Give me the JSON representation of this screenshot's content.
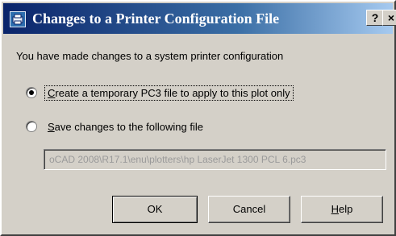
{
  "window": {
    "title": "Changes to a Printer Configuration File",
    "help_glyph": "?",
    "close_glyph": "×"
  },
  "message": "You have made changes to a system printer configuration",
  "options": [
    {
      "accel": "C",
      "rest": "reate a temporary PC3 file to apply to this plot only",
      "selected": true
    },
    {
      "accel": "S",
      "rest": "ave changes to the following file",
      "selected": false
    }
  ],
  "file_path": "oCAD 2008\\R17.1\\enu\\plotters\\hp LaserJet 1300 PCL 6.pc3",
  "buttons": {
    "ok": "OK",
    "cancel": "Cancel",
    "help_accel": "H",
    "help_rest": "elp"
  },
  "icons": {
    "app": "printer-config-icon"
  }
}
